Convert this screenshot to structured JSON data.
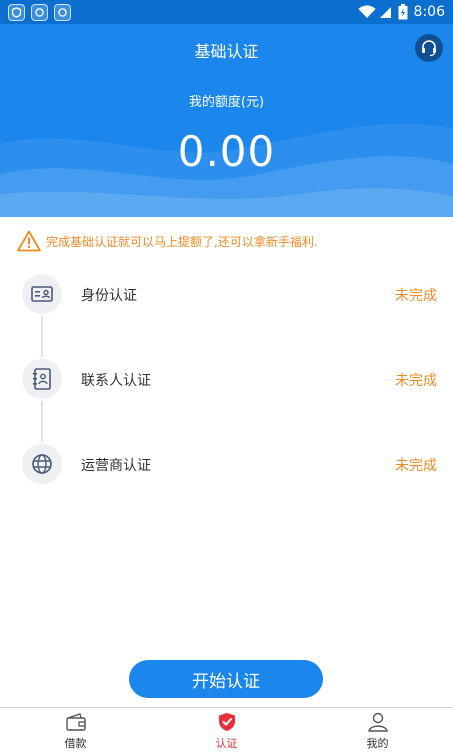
{
  "status_bar": {
    "time": "8:06"
  },
  "header": {
    "title": "基础认证"
  },
  "credit": {
    "label": "我的额度(元)",
    "amount": "0.00"
  },
  "notice": {
    "text": "完成基础认证就可以马上提额了,还可以拿新手福利."
  },
  "steps": [
    {
      "label": "身份认证",
      "status": "未完成",
      "icon": "id-card-icon"
    },
    {
      "label": "联系人认证",
      "status": "未完成",
      "icon": "contacts-book-icon"
    },
    {
      "label": "运营商认证",
      "status": "未完成",
      "icon": "globe-icon"
    }
  ],
  "start_button": {
    "label": "开始认证"
  },
  "tabs": [
    {
      "label": "借款",
      "icon": "wallet-icon",
      "active": false
    },
    {
      "label": "认证",
      "icon": "shield-check-icon",
      "active": true
    },
    {
      "label": "我的",
      "icon": "user-icon",
      "active": false
    }
  ],
  "colors": {
    "primary": "#1b86eb",
    "status_bar": "#0c6fd0",
    "warning": "#f08a25",
    "active_tab": "#e8303a"
  }
}
